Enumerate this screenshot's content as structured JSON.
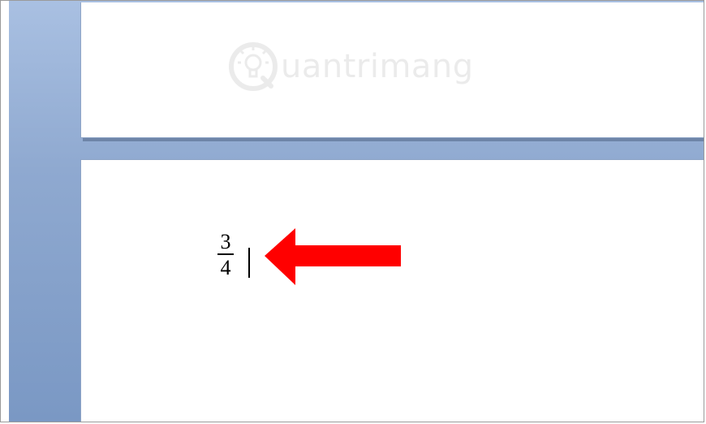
{
  "watermark": {
    "brand": "uantrimang",
    "icon": "lightbulb-icon"
  },
  "document": {
    "equation": {
      "numerator": "3",
      "denominator": "4"
    }
  },
  "annotation": {
    "arrow_color": "#ff0000",
    "arrow_direction": "left"
  },
  "colors": {
    "workspace": "#8fa9d0",
    "page": "#ffffff"
  }
}
